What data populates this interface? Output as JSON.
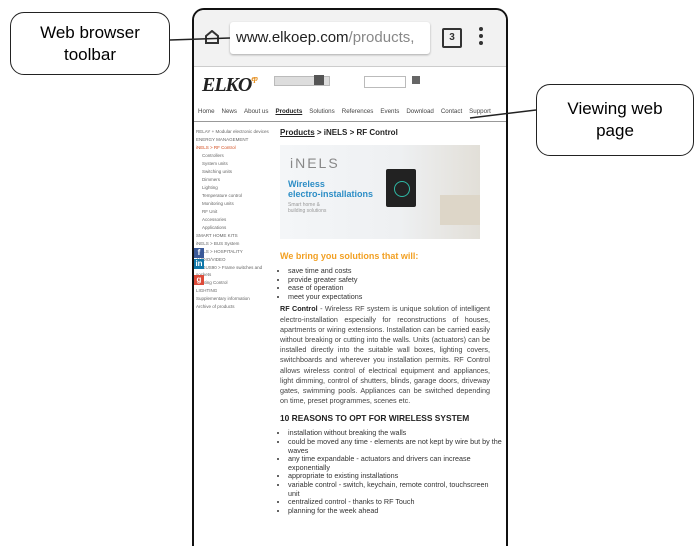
{
  "annotations": {
    "toolbar_callout": "Web browser toolbar",
    "page_callout": "Viewing web page"
  },
  "browser": {
    "url_domain": "www.elkoep.com",
    "url_path": "/products,",
    "tab_count": "3"
  },
  "site": {
    "logo": "ELKO",
    "logo_suffix": "ep",
    "nav": [
      "Home",
      "News",
      "About us",
      "Products",
      "Solutions",
      "References",
      "Events",
      "Download",
      "Contact",
      "Support"
    ]
  },
  "sidebar": {
    "items": [
      "RELAY + Modular electronic devices",
      "ENERGY MANAGEMENT",
      "iNELS > RF Control",
      "Controllers",
      "System units",
      "Switching units",
      "Dimmers",
      "Lighting",
      "Temperature control",
      "Monitoring units",
      "RF Unit",
      "Accessories",
      "Applications",
      "SMART HOME KITS",
      "iNELS > BUS System",
      "iNELS > HOSPITALITY",
      "AUDIO/VIDEO",
      "LOGUS90 > Frame switches and sockets",
      "Lighting Control",
      "LIGHTING",
      "Supplementary information",
      "Archive of products"
    ]
  },
  "main": {
    "breadcrumb_link": "Products",
    "breadcrumb_rest": " > iNELS > RF Control",
    "banner": {
      "brand": "iNELS",
      "line1": "Wireless",
      "line2": "electro-installations",
      "line3": "Smart home &",
      "line4": "building solutions"
    },
    "bring_title": "We bring you solutions that will:",
    "bullets": [
      "save time and costs",
      "provide greater safety",
      "ease of operation",
      "meet your expectations"
    ],
    "para_bold": "RF Control",
    "para_text": " - Wireless RF system is unique solution of intelligent electro-installation especially for reconstructions of houses, apartments or wiring extensions. Installation can be carried easily without breaking or cutting into the walls. Units (actuators) can be installed directly into the suitable wall boxes, lighting covers, switchboards and wherever you installation permits. RF Control allows wireless control of electrical equipment and appliances, light dimming, control of shutters, blinds, garage doors, driveway gates, swimming pools. Appliances can be switched depending on time, preset programmes, scenes etc.",
    "reasons_title": "10 REASONS TO OPT FOR WIRELESS SYSTEM",
    "reasons": [
      "installation without breaking the walls",
      "could be moved any time - elements are not kept by wire but by the waves",
      "any time expandable - actuators and drivers can increase exponentially",
      "appropriate to existing installations",
      "variable control - switch, keychain, remote control, touchscreen unit",
      "centralized control - thanks to RF Touch",
      "planning for the week ahead"
    ]
  }
}
